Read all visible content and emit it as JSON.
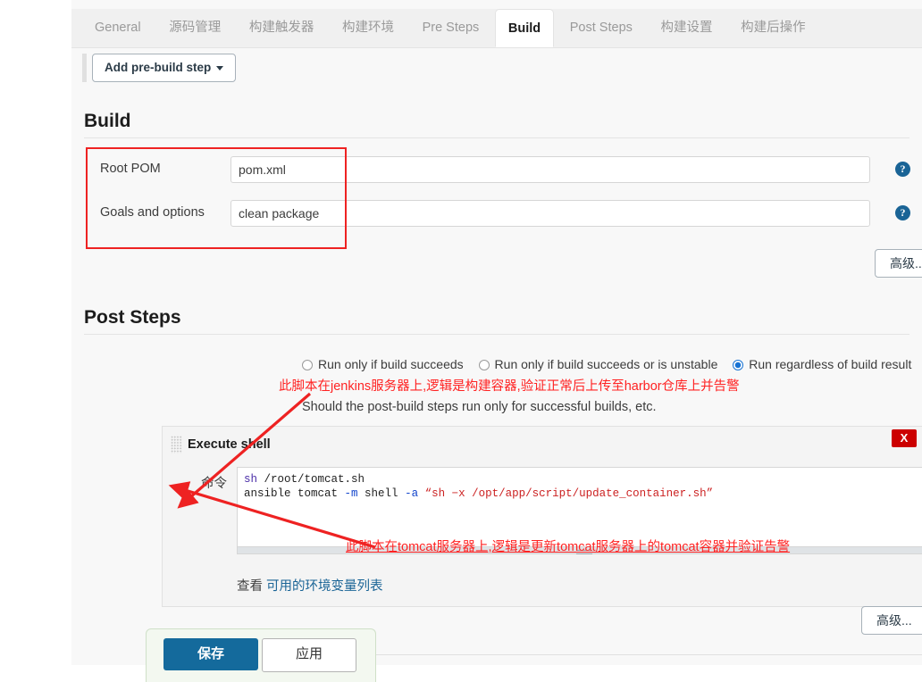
{
  "tabs": [
    {
      "label": "General",
      "active": false
    },
    {
      "label": "源码管理",
      "active": false
    },
    {
      "label": "构建触发器",
      "active": false
    },
    {
      "label": "构建环境",
      "active": false
    },
    {
      "label": "Pre Steps",
      "active": false
    },
    {
      "label": "Build",
      "active": true
    },
    {
      "label": "Post Steps",
      "active": false
    },
    {
      "label": "构建设置",
      "active": false
    },
    {
      "label": "构建后操作",
      "active": false
    }
  ],
  "toolbar": {
    "add_prebuild_label": "Add pre-build step"
  },
  "build_section": {
    "title": "Build",
    "fields": [
      {
        "label": "Root POM",
        "value": "pom.xml",
        "help": "?"
      },
      {
        "label": "Goals and options",
        "value": "clean package",
        "help": "?"
      }
    ],
    "advanced_label": "高级..."
  },
  "post_steps_section": {
    "title": "Post Steps",
    "radios": [
      {
        "label": "Run only if build succeeds",
        "checked": false
      },
      {
        "label": "Run only if build succeeds or is unstable",
        "checked": false
      },
      {
        "label": "Run regardless of build result",
        "checked": true
      }
    ],
    "hint": "Should the post-build steps run only for successful builds, etc.",
    "shell": {
      "title": "Execute shell",
      "close_label": "X",
      "help": "?",
      "command_label": "命令",
      "command_lines": [
        {
          "tokens": [
            {
              "t": "sh",
              "c": "kw"
            },
            {
              "t": " /root/tomcat.sh",
              "c": ""
            }
          ]
        },
        {
          "tokens": [
            {
              "t": "ansible tomcat ",
              "c": ""
            },
            {
              "t": "-m",
              "c": "flag"
            },
            {
              "t": " shell ",
              "c": ""
            },
            {
              "t": "-a",
              "c": "flag"
            },
            {
              "t": " “sh −x /opt/app/script/update_container.sh”",
              "c": "str"
            }
          ]
        }
      ],
      "env_prefix": "查看 ",
      "env_link": "可用的环境变量列表",
      "advanced_label": "高级..."
    }
  },
  "save_bar": {
    "save_label": "保存",
    "apply_label": "应用"
  },
  "annotations": {
    "note_jenkins": "此脚本在jenkins服务器上,逻辑是构建容器,验证正常后上传至harbor仓库上并告警",
    "note_tomcat": "此脚本在tomcat服务器上,逻辑是更新tomcat服务器上的tomcat容器并验证告警"
  },
  "colors": {
    "accent_blue": "#1873d3",
    "save_blue": "#146a9c",
    "help_blue": "#1a6496",
    "annotation_red": "#ff2222",
    "close_red": "#cc0000",
    "box_red": "#ee2222"
  }
}
